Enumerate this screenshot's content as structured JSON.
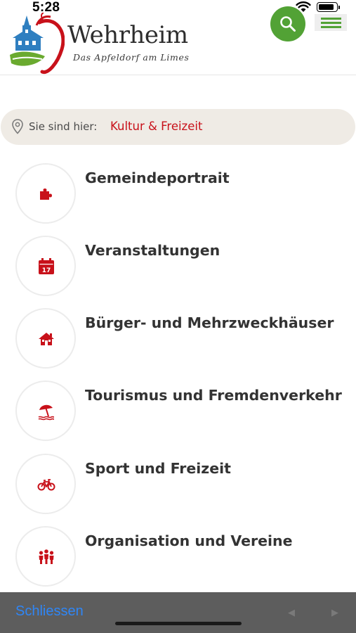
{
  "status_bar": {
    "time": "5:28"
  },
  "header": {
    "brand_name": "Wehrheim",
    "brand_tagline": "Das Apfeldorf am Limes"
  },
  "breadcrumb": {
    "label": "Sie sind hier:",
    "current": "Kultur & Freizeit"
  },
  "menu_items": [
    {
      "title": "Gemeindeportrait",
      "icon": "puzzle-icon"
    },
    {
      "title": "Veranstaltungen",
      "icon": "calendar-icon"
    },
    {
      "title": "Bürger- und Mehrzweckhäuser",
      "icon": "house-icon"
    },
    {
      "title": "Tourismus und Fremdenverkehr",
      "icon": "beach-umbrella-icon"
    },
    {
      "title": "Sport und Freizeit",
      "icon": "bicycle-icon"
    },
    {
      "title": "Organisation  und Vereine",
      "icon": "people-icon"
    }
  ],
  "icons": {
    "calendar_day": "17"
  },
  "toolbar": {
    "close_label": "Schliessen",
    "back_glyph": "◀",
    "forward_glyph": "▶"
  },
  "colors": {
    "accent_red": "#c8111a",
    "brand_green": "#52a235",
    "breadcrumb_bg": "#efebe5",
    "toolbar_bg": "#5d5d5d",
    "link_blue": "#2f86f6"
  }
}
